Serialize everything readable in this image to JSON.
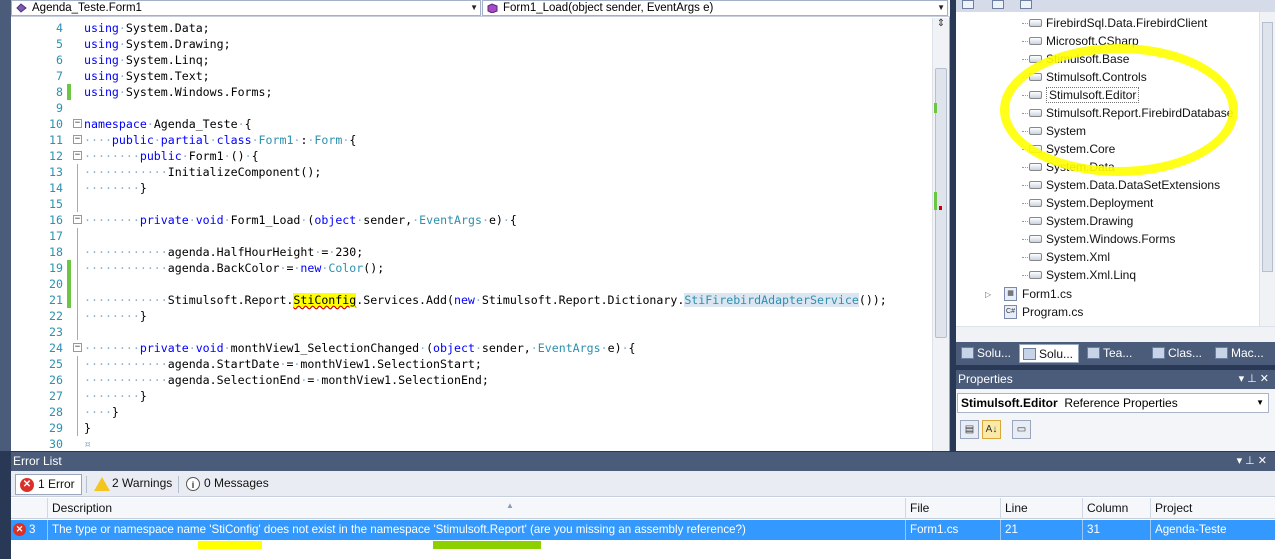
{
  "editor": {
    "class_combo": "Agenda_Teste.Form1",
    "method_combo": "Form1_Load(object sender, EventArgs e)",
    "lines": [
      {
        "n": "4",
        "segs": [
          [
            "kw",
            "using"
          ],
          [
            "ws",
            "·"
          ],
          [
            "t",
            "System.Data;"
          ]
        ]
      },
      {
        "n": "5",
        "segs": [
          [
            "kw",
            "using"
          ],
          [
            "ws",
            "·"
          ],
          [
            "t",
            "System.Drawing;"
          ]
        ]
      },
      {
        "n": "6",
        "segs": [
          [
            "kw",
            "using"
          ],
          [
            "ws",
            "·"
          ],
          [
            "t",
            "System.Linq;"
          ]
        ]
      },
      {
        "n": "7",
        "segs": [
          [
            "kw",
            "using"
          ],
          [
            "ws",
            "·"
          ],
          [
            "t",
            "System.Text;"
          ]
        ]
      },
      {
        "n": "8",
        "segs": [
          [
            "kw",
            "using"
          ],
          [
            "ws",
            "·"
          ],
          [
            "t",
            "System.Windows.Forms;"
          ]
        ]
      },
      {
        "n": "9",
        "segs": []
      },
      {
        "n": "10",
        "segs": [
          [
            "kw",
            "namespace"
          ],
          [
            "ws",
            "·"
          ],
          [
            "t",
            "Agenda_Teste"
          ],
          [
            "ws",
            "·"
          ],
          [
            "t",
            "{"
          ]
        ]
      },
      {
        "n": "11",
        "segs": [
          [
            "ws",
            "····"
          ],
          [
            "kw",
            "public"
          ],
          [
            "ws",
            "·"
          ],
          [
            "kw",
            "partial"
          ],
          [
            "ws",
            "·"
          ],
          [
            "kw",
            "class"
          ],
          [
            "ws",
            "·"
          ],
          [
            "ty",
            "Form1"
          ],
          [
            "ws",
            "·"
          ],
          [
            "t",
            ":"
          ],
          [
            "ws",
            "·"
          ],
          [
            "ty",
            "Form"
          ],
          [
            "ws",
            "·"
          ],
          [
            "t",
            "{"
          ]
        ]
      },
      {
        "n": "12",
        "segs": [
          [
            "ws",
            "········"
          ],
          [
            "kw",
            "public"
          ],
          [
            "ws",
            "·"
          ],
          [
            "t",
            "Form1"
          ],
          [
            "ws",
            "·"
          ],
          [
            "t",
            "()"
          ],
          [
            "ws",
            "·"
          ],
          [
            "t",
            "{"
          ]
        ]
      },
      {
        "n": "13",
        "segs": [
          [
            "ws",
            "············"
          ],
          [
            "t",
            "InitializeComponent();"
          ]
        ]
      },
      {
        "n": "14",
        "segs": [
          [
            "ws",
            "········"
          ],
          [
            "t",
            "}"
          ]
        ]
      },
      {
        "n": "15",
        "segs": []
      },
      {
        "n": "16",
        "segs": [
          [
            "ws",
            "········"
          ],
          [
            "kw",
            "private"
          ],
          [
            "ws",
            "·"
          ],
          [
            "kw",
            "void"
          ],
          [
            "ws",
            "·"
          ],
          [
            "t",
            "Form1_Load"
          ],
          [
            "ws",
            "·"
          ],
          [
            "t",
            "("
          ],
          [
            "kw",
            "object"
          ],
          [
            "ws",
            "·"
          ],
          [
            "t",
            "sender,"
          ],
          [
            "ws",
            "·"
          ],
          [
            "ty",
            "EventArgs"
          ],
          [
            "ws",
            "·"
          ],
          [
            "t",
            "e)"
          ],
          [
            "ws",
            "·"
          ],
          [
            "t",
            "{"
          ]
        ]
      },
      {
        "n": "17",
        "segs": []
      },
      {
        "n": "18",
        "segs": [
          [
            "ws",
            "············"
          ],
          [
            "t",
            "agenda.HalfHourHeight"
          ],
          [
            "ws",
            "·"
          ],
          [
            "t",
            "="
          ],
          [
            "ws",
            "·"
          ],
          [
            "t",
            "230;"
          ]
        ]
      },
      {
        "n": "19",
        "segs": [
          [
            "ws",
            "············"
          ],
          [
            "t",
            "agenda.BackColor"
          ],
          [
            "ws",
            "·"
          ],
          [
            "t",
            "="
          ],
          [
            "ws",
            "·"
          ],
          [
            "kw",
            "new"
          ],
          [
            "ws",
            "·"
          ],
          [
            "ty",
            "Color"
          ],
          [
            "t",
            "();"
          ]
        ]
      },
      {
        "n": "20",
        "segs": []
      },
      {
        "n": "21",
        "segs": [
          [
            "ws",
            "············"
          ],
          [
            "t",
            "Stimulsoft.Report."
          ],
          [
            "hl",
            "StiConfig"
          ],
          [
            "t",
            ".Services.Add("
          ],
          [
            "kw",
            "new"
          ],
          [
            "ws",
            "·"
          ],
          [
            "t",
            "Stimulsoft.Report.Dictionary."
          ],
          [
            "selty",
            "StiFirebirdAdapterService"
          ],
          [
            "t",
            "());"
          ]
        ]
      },
      {
        "n": "22",
        "segs": [
          [
            "ws",
            "········"
          ],
          [
            "t",
            "}"
          ]
        ]
      },
      {
        "n": "23",
        "segs": []
      },
      {
        "n": "24",
        "segs": [
          [
            "ws",
            "········"
          ],
          [
            "kw",
            "private"
          ],
          [
            "ws",
            "·"
          ],
          [
            "kw",
            "void"
          ],
          [
            "ws",
            "·"
          ],
          [
            "t",
            "monthView1_SelectionChanged"
          ],
          [
            "ws",
            "·"
          ],
          [
            "t",
            "("
          ],
          [
            "kw",
            "object"
          ],
          [
            "ws",
            "·"
          ],
          [
            "t",
            "sender,"
          ],
          [
            "ws",
            "·"
          ],
          [
            "ty",
            "EventArgs"
          ],
          [
            "ws",
            "·"
          ],
          [
            "t",
            "e)"
          ],
          [
            "ws",
            "·"
          ],
          [
            "t",
            "{"
          ]
        ]
      },
      {
        "n": "25",
        "segs": [
          [
            "ws",
            "············"
          ],
          [
            "t",
            "agenda.StartDate"
          ],
          [
            "ws",
            "·"
          ],
          [
            "t",
            "="
          ],
          [
            "ws",
            "·"
          ],
          [
            "t",
            "monthView1.SelectionStart;"
          ]
        ]
      },
      {
        "n": "26",
        "segs": [
          [
            "ws",
            "············"
          ],
          [
            "t",
            "agenda.SelectionEnd"
          ],
          [
            "ws",
            "·"
          ],
          [
            "t",
            "="
          ],
          [
            "ws",
            "·"
          ],
          [
            "t",
            "monthView1.SelectionEnd;"
          ]
        ]
      },
      {
        "n": "27",
        "segs": [
          [
            "ws",
            "········"
          ],
          [
            "t",
            "}"
          ]
        ]
      },
      {
        "n": "28",
        "segs": [
          [
            "ws",
            "····"
          ],
          [
            "t",
            "}"
          ]
        ]
      },
      {
        "n": "29",
        "segs": [
          [
            "t",
            "}"
          ]
        ]
      },
      {
        "n": "30",
        "segs": [
          [
            "ws",
            "¤"
          ]
        ]
      }
    ]
  },
  "solution_explorer": {
    "references": [
      "FirebirdSql.Data.FirebirdClient",
      "Microsoft.CSharp",
      "Stimulsoft.Base",
      "Stimulsoft.Controls",
      "Stimulsoft.Editor",
      "Stimulsoft.Report.FirebirdDatabase",
      "System",
      "System.Core",
      "System.Data",
      "System.Data.DataSetExtensions",
      "System.Deployment",
      "System.Drawing",
      "System.Windows.Forms",
      "System.Xml",
      "System.Xml.Linq"
    ],
    "files": [
      "Form1.cs",
      "Program.cs"
    ],
    "tabs": [
      "Solu...",
      "Solu...",
      "Tea...",
      "Clas...",
      "Mac..."
    ]
  },
  "properties": {
    "title": "Properties",
    "object_name": "Stimulsoft.Editor",
    "object_type": "Reference Properties"
  },
  "error_list": {
    "title": "Error List",
    "errors_btn": "1 Error",
    "warnings_btn": "2 Warnings",
    "messages_btn": "0 Messages",
    "columns": {
      "description": "Description",
      "file": "File",
      "line": "Line",
      "column": "Column",
      "project": "Project"
    },
    "rows": [
      {
        "num": "3",
        "description": "The type or namespace name 'StiConfig' does not exist in the namespace 'Stimulsoft.Report' (are you missing an assembly reference?)",
        "file": "Form1.cs",
        "line": "21",
        "column": "31",
        "project": "Agenda-Teste"
      }
    ]
  },
  "colors": {
    "keyword": "#0000ff",
    "type": "#2b91af",
    "highlight": "#ffff00",
    "selection_row": "#3399ff"
  }
}
